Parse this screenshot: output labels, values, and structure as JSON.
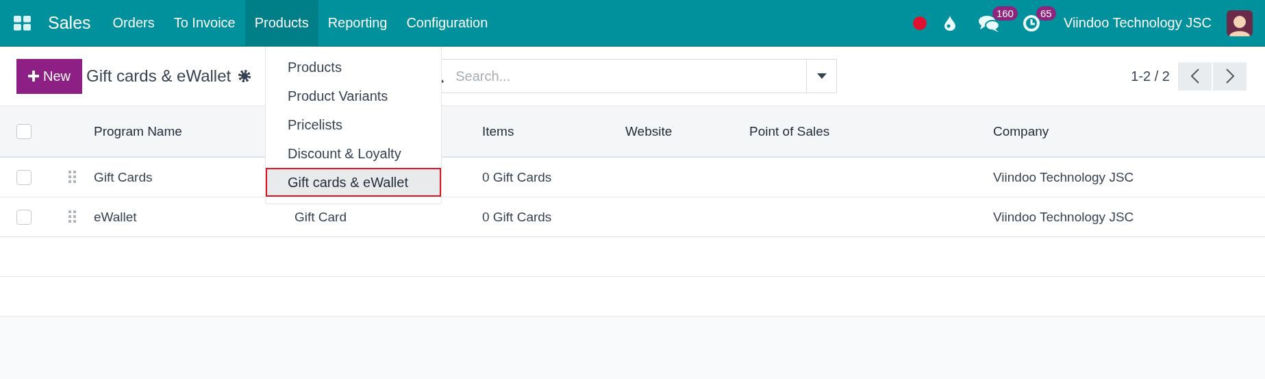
{
  "navbar": {
    "app": "Sales",
    "menus": [
      {
        "label": "Orders",
        "selected": false
      },
      {
        "label": "To Invoice",
        "selected": false
      },
      {
        "label": "Products",
        "selected": true
      },
      {
        "label": "Reporting",
        "selected": false
      },
      {
        "label": "Configuration",
        "selected": false
      }
    ],
    "messages_badge": "160",
    "activities_badge": "65",
    "company": "Viindoo Technology JSC"
  },
  "control_panel": {
    "new_button": "New",
    "title": "Gift cards & eWallet",
    "search": {
      "placeholder": "Search..."
    },
    "pager": "1-2 / 2"
  },
  "products_menu": [
    {
      "label": "Products",
      "selected": false
    },
    {
      "label": "Product Variants",
      "selected": false
    },
    {
      "label": "Pricelists",
      "selected": false
    },
    {
      "label": "Discount & Loyalty",
      "selected": false
    },
    {
      "label": "Gift cards & eWallet",
      "selected": true
    }
  ],
  "table": {
    "all_checked": false,
    "columns": [
      "Program Name",
      "Items",
      "Website",
      "Point of Sales",
      "Company"
    ],
    "rows": [
      {
        "checked": false,
        "program_name": "Gift Cards",
        "items": "0 Gift Cards",
        "company": "Viindoo Technology JSC"
      },
      {
        "checked": false,
        "program_name": "eWallet",
        "column_2": "Gift Card",
        "items": "0 Gift Cards",
        "company": "Viindoo Technology JSC"
      }
    ]
  }
}
